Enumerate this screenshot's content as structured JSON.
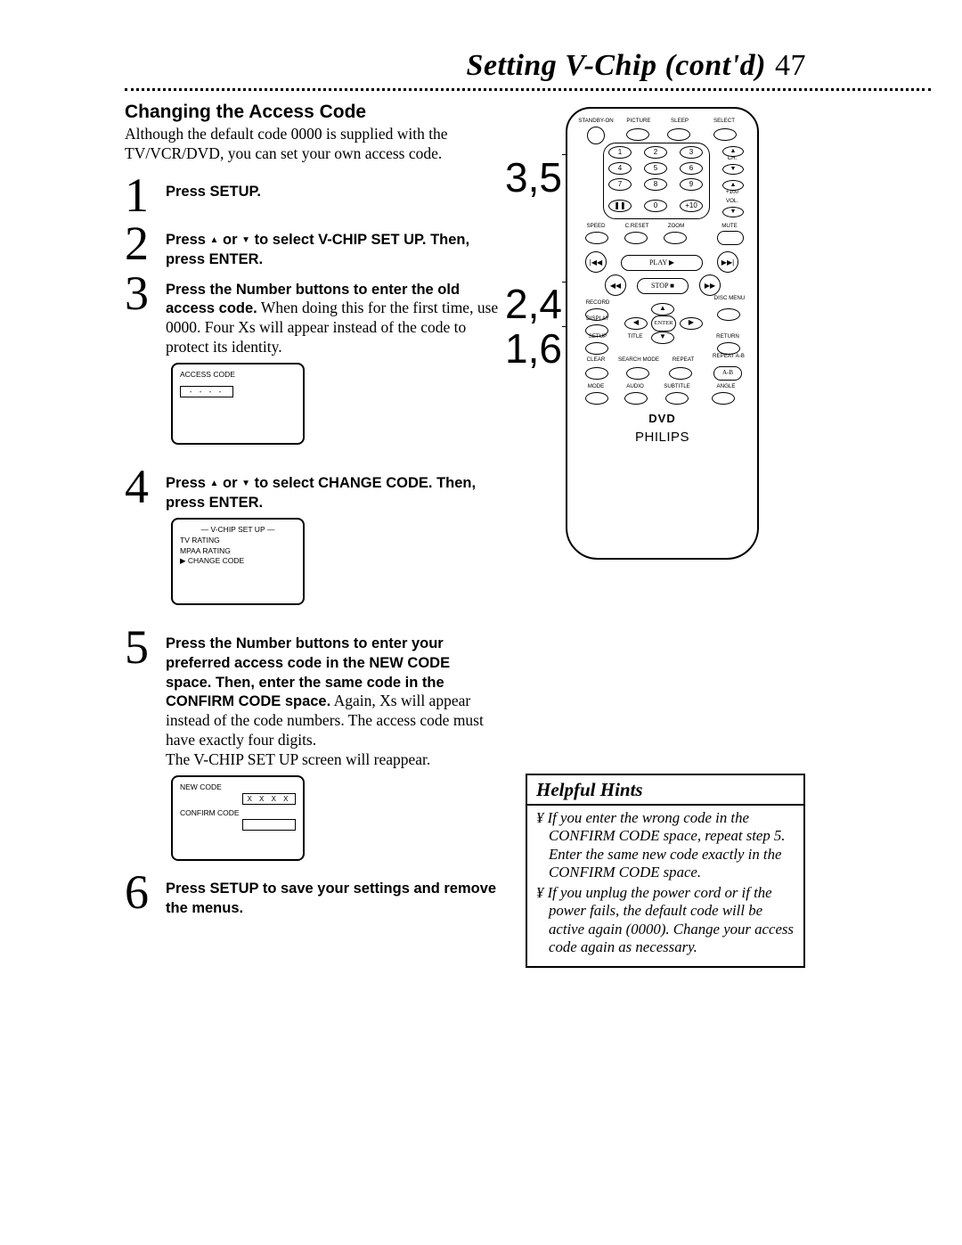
{
  "header": {
    "title": "Setting V-Chip (cont'd)",
    "page": "47"
  },
  "section_title": "Changing the Access Code",
  "intro": "Although the default code 0000 is supplied with the TV/VCR/DVD, you can set your own access code.",
  "steps": {
    "s1": {
      "num": "1",
      "bold1": "Press SETUP."
    },
    "s2": {
      "num": "2",
      "pre": "Press ",
      "mid": " or ",
      "bold2": " to select V-CHIP SET UP. Then, press ENTER."
    },
    "s3": {
      "num": "3",
      "bold1": "Press the Number buttons to enter the old access code.",
      "rest": " When doing this for the first time, use 0000. Four Xs will appear instead of the code to protect its identity."
    },
    "s4": {
      "num": "4",
      "pre": "Press ",
      "mid": " or ",
      "bold2": " to select CHANGE CODE. Then, press ENTER."
    },
    "s5": {
      "num": "5",
      "bold1": "Press the Number buttons to enter your preferred access code in the NEW CODE space. Then, enter the same code in the CONFIRM CODE space.",
      "rest": " Again, Xs will appear instead of the code numbers. The access code must have exactly four digits.",
      "after": "The V-CHIP SET UP screen will reappear."
    },
    "s6": {
      "num": "6",
      "bold1": "Press SETUP to save your settings and remove the menus."
    }
  },
  "osd1": {
    "title": "ACCESS CODE"
  },
  "osd2": {
    "line1": "— V-CHIP SET UP —",
    "line2": "TV RATING",
    "line3": "MPAA RATING",
    "line4": "▶ CHANGE CODE"
  },
  "osd3": {
    "line1": "NEW CODE",
    "val1": "X X X X",
    "line2": "CONFIRM CODE"
  },
  "callouts": {
    "c1": "3,5",
    "c2": "2,4",
    "c3": "1,6"
  },
  "remote": {
    "row1": [
      "STANDBY-ON",
      "PICTURE",
      "SLEEP",
      "SELECT"
    ],
    "numbers": [
      "1",
      "2",
      "3",
      "4",
      "5",
      "6",
      "7",
      "8",
      "9",
      "0",
      "+10"
    ],
    "ch_label": "CH.",
    "vol_label": "VOL.",
    "plus100": "+100",
    "row3": [
      "SPEED",
      "C.RESET",
      "ZOOM",
      "MUTE"
    ],
    "transport": [
      "◀◀",
      "PLAY ▶",
      "▶▶",
      "STOP ■"
    ],
    "rec": "RECORD",
    "disc": "DISC MENU",
    "row5a": [
      "DISPLAY",
      "",
      "ENTER",
      ""
    ],
    "row5b": [
      "SETUP",
      "TITLE",
      "",
      "RETURN"
    ],
    "row6": [
      "CLEAR",
      "SEARCH MODE",
      "REPEAT",
      "REPEAT A-B"
    ],
    "row7": [
      "MODE",
      "AUDIO",
      "SUBTITLE",
      "ANGLE"
    ],
    "logo": "DVD",
    "brand": "PHILIPS",
    "pause": "❚❚"
  },
  "hints": {
    "title": "Helpful Hints",
    "p1": "¥ If you enter the wrong code in the CONFIRM CODE space, repeat step 5. Enter the same new code exactly in the CONFIRM CODE space.",
    "p2": "¥ If you unplug the power cord or if the power fails, the default code will be active again (0000). Change your access code again as necessary."
  }
}
